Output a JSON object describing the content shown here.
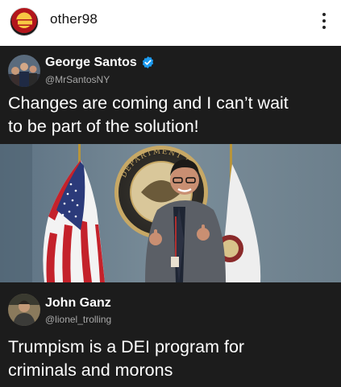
{
  "post": {
    "username": "other98"
  },
  "tweets": [
    {
      "name": "George Santos",
      "handle": "@MrSantosNY",
      "verified": true,
      "text_lines": [
        "Changes are coming and I can’t wait",
        "to be part of the solution!"
      ]
    },
    {
      "name": "John Ganz",
      "handle": "@lionel_trolling",
      "verified": false,
      "text_lines": [
        "Trumpism is a DEI program for",
        "criminals and morons"
      ]
    }
  ],
  "photo": {
    "seal_text": "DEPARTMENT OF"
  },
  "colors": {
    "card_background": "#1c1c1c",
    "verified_badge": "#1d9bf0",
    "handle_text": "#a8a8a8"
  },
  "icons": {
    "verified": "verified-badge-icon",
    "more": "more-options-icon"
  }
}
